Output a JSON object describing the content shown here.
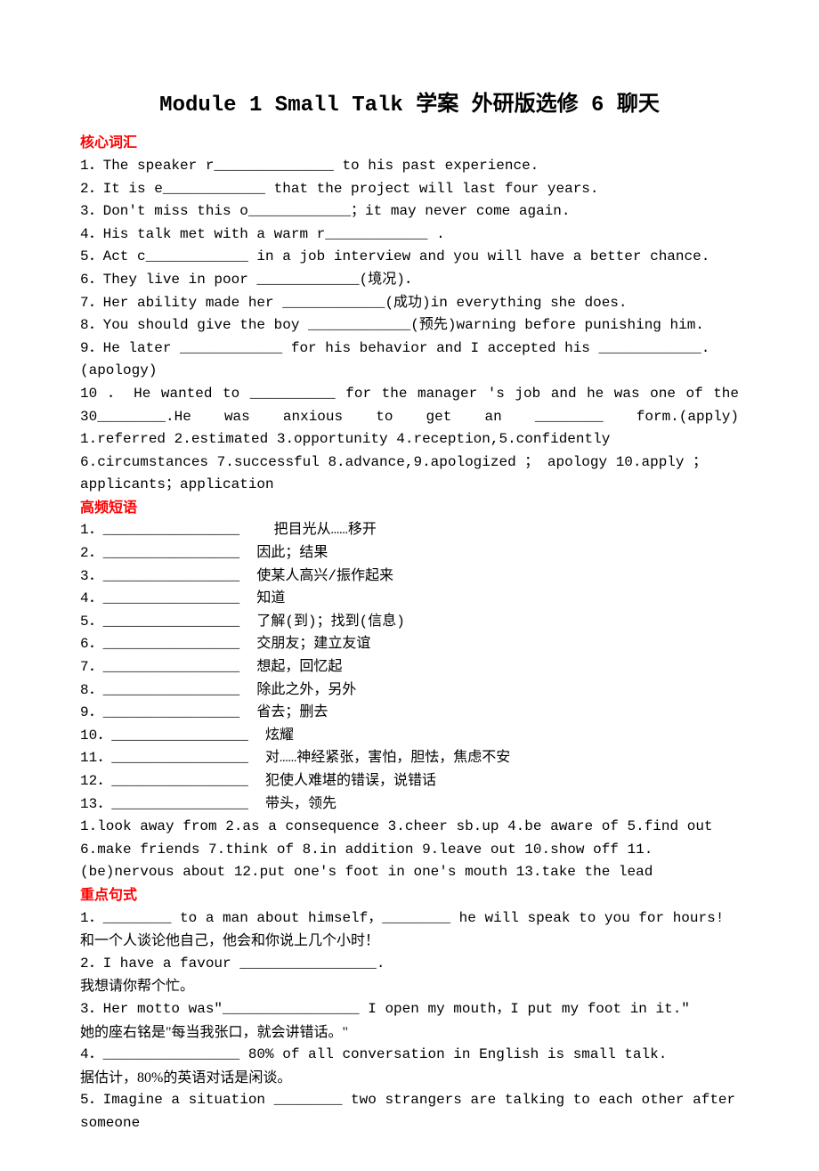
{
  "title": "Module 1 Small Talk  学案 外研版选修 6 聊天",
  "sections": {
    "vocab_header": "核心词汇",
    "vocab": [
      "1．The speaker r______________ to his past experience.",
      "2．It is e____________ that the project will last four years.",
      "3．Don't miss this o____________；it may never come again.",
      "4．His talk met with a warm r____________ .",
      "5．Act c____________ in a job interview and you will have a better chance.",
      "6．They live in poor ____________(境况)．",
      "7．Her ability made her ____________(成功)in everything she does.",
      "8．You should give the boy ____________(预先)warning before punishing him.",
      "9．He later ____________ for his behavior and I accepted his ____________.(apology)",
      "10 ． He wanted to __________ for the manager 's job and he was one of the 30________.He was anxious to get an ________ form.(apply)"
    ],
    "vocab_answers": "1.referred     2.estimated     3.opportunity     4.reception,5.confidently 6.circumstances   7.successful   8.advance,9.apologized ； apology   10.apply ；applicants；application",
    "phrase_header": "高频短语",
    "phrases": [
      "1．________________    把目光从……移开",
      "2．________________  因此；结果",
      "3．________________  使某人高兴/振作起来",
      "4．________________  知道",
      "5．________________  了解(到)；找到(信息)",
      "6．________________  交朋友；建立友谊",
      "7．________________  想起，回忆起",
      "8．________________  除此之外，另外",
      "9．________________  省去；删去",
      "10．________________  炫耀",
      "11．________________  对……神经紧张，害怕，胆怯，焦虑不安",
      "12．________________  犯使人难堪的错误，说错话",
      "13．________________  带头，领先"
    ],
    "phrase_answers": "1.look away from  2.as a consequence  3.cheer sb.up  4.be aware of  5.find out 6.make friends  7.think of  8.in addition  9.leave out  10.show off  11.(be)nervous about  12.put one's foot in one's mouth  13.take the lead",
    "sentence_header": "重点句式",
    "sentences": [
      "1．________ to a man about himself，________ he will speak to you for hours!",
      "和一个人谈论他自己，他会和你说上几个小时！",
      "2．I have a favour ________________.",
      "我想请你帮个忙。",
      "3．Her motto was\"________________ I open my mouth，I put my foot in it.\"",
      "她的座右铭是\"每当我张口，就会讲错话。\"",
      "4．________________ 80% of all conversation in English is small talk.",
      "据估计，80%的英语对话是闲谈。",
      "5．Imagine a situation ________ two strangers are talking to each other after someone"
    ]
  }
}
